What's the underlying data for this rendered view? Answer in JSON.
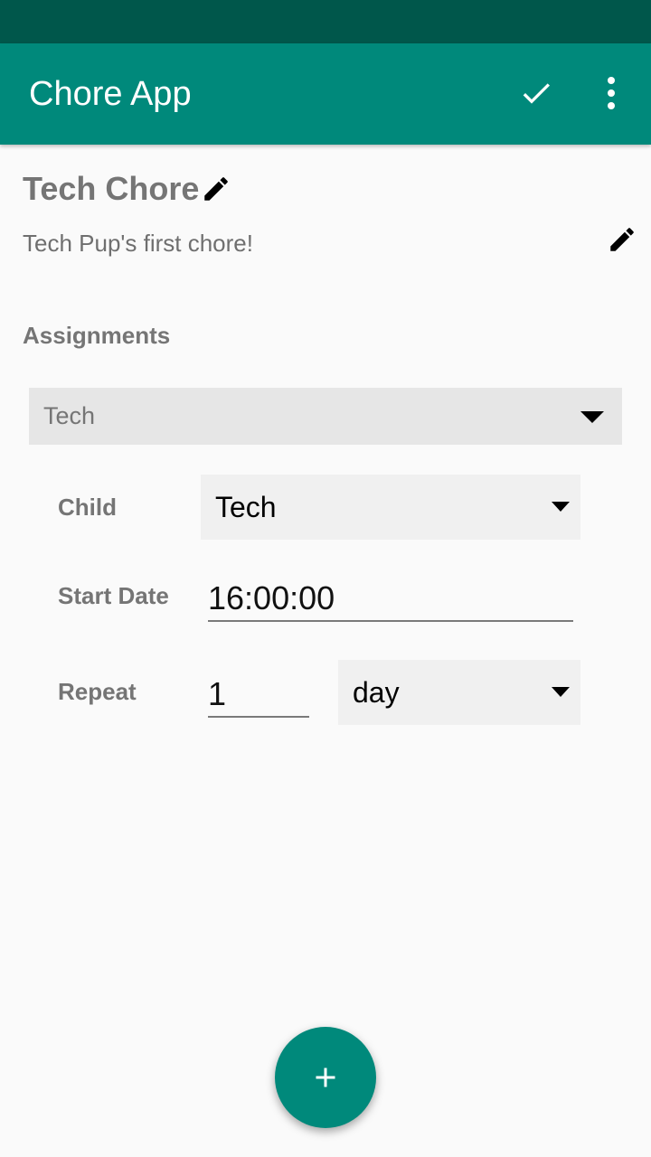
{
  "app_bar": {
    "title": "Chore App",
    "actions": [
      {
        "icon": "check-icon"
      },
      {
        "icon": "more-vert-icon"
      }
    ],
    "color": "#00897b",
    "status_bar_color": "#00574b"
  },
  "chore": {
    "title": "Tech Chore",
    "description": "Tech Pup's first chore!"
  },
  "assignments": {
    "label": "Assignments",
    "selected": "Tech",
    "child_label": "Child",
    "child_value": "Tech",
    "start_date_label": "Start Date",
    "start_date_value": "16:00:00",
    "repeat_label": "Repeat",
    "repeat_count": "1",
    "repeat_unit": "day"
  },
  "fab": {
    "icon": "add-icon",
    "color": "#00897b"
  }
}
